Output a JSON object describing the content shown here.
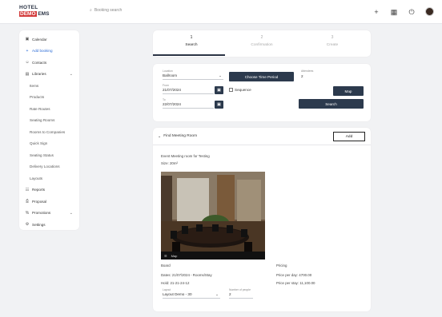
{
  "app": {
    "logo_line1": "HOTEL",
    "logo_line2_a": "DEMO",
    "logo_line2_b": "EMS",
    "search_placeholder": "Booking search"
  },
  "colors": {
    "dark": "#2c3a4d",
    "accent": "#2b6bd6",
    "logo_red": "#d23a3a"
  },
  "sidebar": {
    "items": [
      {
        "label": "Calendar",
        "icon": "calendar-icon"
      },
      {
        "label": "Add booking",
        "icon": "plus-icon"
      },
      {
        "label": "Contacts",
        "icon": "people-icon"
      },
      {
        "label": "Libraries",
        "icon": "book-icon"
      },
      {
        "label": "Items"
      },
      {
        "label": "Products"
      },
      {
        "label": "Rate Routes"
      },
      {
        "label": "Seating Rooms"
      },
      {
        "label": "Rooms to Companies"
      },
      {
        "label": "Quick Sign"
      },
      {
        "label": "Seating Status"
      },
      {
        "label": "Delivery Locations"
      },
      {
        "label": "Layouts"
      },
      {
        "label": "Reports",
        "icon": "chart-icon"
      },
      {
        "label": "Proposal",
        "icon": "printer-icon"
      },
      {
        "label": "Promotions",
        "icon": "percent-icon"
      },
      {
        "label": "Settings",
        "icon": "gear-icon"
      }
    ]
  },
  "steps": [
    {
      "num": "1",
      "label": "Search"
    },
    {
      "num": "2",
      "label": "Confirmation"
    },
    {
      "num": "3",
      "label": "Create"
    }
  ],
  "form": {
    "location_label": "Location",
    "location_value": "Ballroom",
    "time_period_button": "Choose Time Period",
    "attendees_label": "Attendees",
    "attendees_value": "2",
    "from_label": "From",
    "from_value": "21/07/2024",
    "to_label": "To",
    "to_value": "22/07/2024",
    "sequence_label": "Sequence",
    "map_button": "Map",
    "search_button": "Search"
  },
  "rooms": {
    "section_title": "Find Meeting Room",
    "add_button": "Add",
    "room_name": "Event Meeting room for Testing",
    "room_size": "Size: 20m²",
    "photo_caption": "Map",
    "left_heading": "Board",
    "left_dates": "Dates: 21/07/2024 - Rooms/Stay",
    "left_capacity": "Hold: 21-21-24-12",
    "layout_label": "Layout",
    "layout_value": "Layout Demo - 30",
    "quantity_label": "Number of people",
    "quantity_value": "2",
    "right_heading": "Pricing",
    "price_room": "Price per day: 4700.00",
    "price_total": "Price per stay: 11,100.00"
  }
}
